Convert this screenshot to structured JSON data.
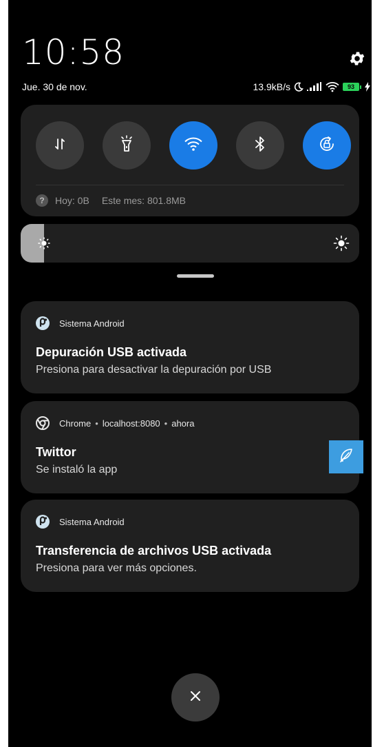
{
  "status_bar": {
    "time": "10:58",
    "date": "Jue. 30 de nov.",
    "network_speed": "13.9kB/s",
    "battery_level": "93",
    "icons": [
      "moon-icon",
      "signal-icon",
      "wifi-icon",
      "battery-icon",
      "charging-icon"
    ]
  },
  "quick_settings": {
    "tiles": [
      {
        "name": "mobile-data",
        "icon": "data-arrows-icon",
        "active": false
      },
      {
        "name": "flashlight",
        "icon": "flashlight-icon",
        "active": false
      },
      {
        "name": "wifi",
        "icon": "wifi-icon",
        "active": true
      },
      {
        "name": "bluetooth",
        "icon": "bluetooth-icon",
        "active": false
      },
      {
        "name": "rotation-lock",
        "icon": "rotation-lock-icon",
        "active": true
      }
    ],
    "data_usage": {
      "today": "Hoy: 0B",
      "month": "Este mes: 801.8MB"
    },
    "accent_color": "#1a7ce6"
  },
  "brightness": {
    "level_fraction": 0.07
  },
  "notifications": [
    {
      "app": "Sistema Android",
      "icon": "android-system-icon",
      "title": "Depuración USB activada",
      "body": "Presiona para desactivar la depuración por USB"
    },
    {
      "app": "Chrome",
      "source": "localhost:8080",
      "time": "ahora",
      "icon": "chrome-icon",
      "title": "Twittor",
      "body": "Se instaló la app",
      "large_icon": "feather-icon",
      "large_icon_color": "#3d9de0"
    },
    {
      "app": "Sistema Android",
      "icon": "android-system-icon",
      "title": "Transferencia de archivos USB activada",
      "body": "Presiona para ver más opciones."
    }
  ],
  "dismiss_all": {
    "icon": "close-icon"
  }
}
